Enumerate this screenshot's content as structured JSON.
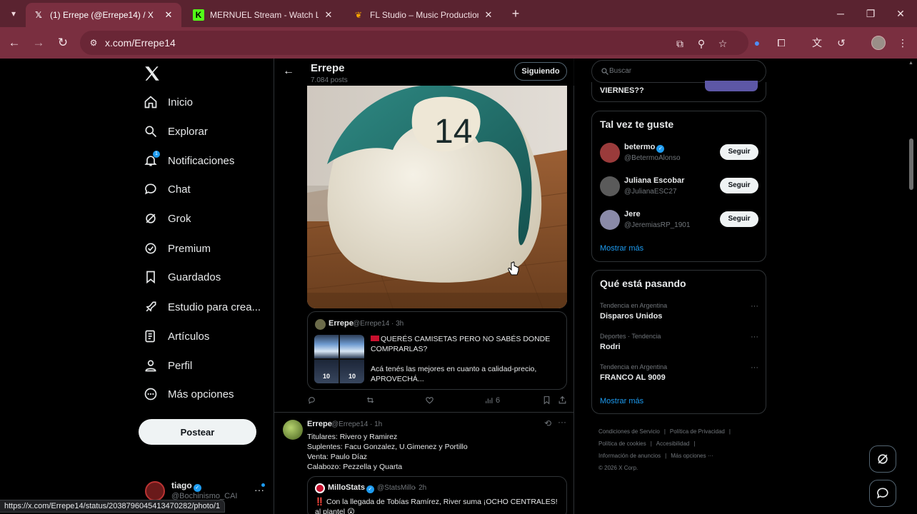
{
  "browser": {
    "tabs": [
      {
        "title": "(1) Errepe (@Errepe14) / X",
        "favicon": "x-logo"
      },
      {
        "title": "MERNUEL Stream - Watch Live",
        "favicon": "kick-logo"
      },
      {
        "title": "FL Studio – Music Production Software",
        "favicon": "fl-studio-logo"
      }
    ],
    "url": "x.com/Errepe14",
    "status_url": "https://x.com/Errepe14/status/2038796045413470282/photo/1",
    "accent": "#7a2f40"
  },
  "nav": {
    "items": [
      {
        "label": "Inicio",
        "icon": "home-icon"
      },
      {
        "label": "Explorar",
        "icon": "search-icon"
      },
      {
        "label": "Notificaciones",
        "icon": "bell-icon",
        "badge": "1"
      },
      {
        "label": "Chat",
        "icon": "chat-icon"
      },
      {
        "label": "Grok",
        "icon": "grok-icon"
      },
      {
        "label": "Premium",
        "icon": "premium-icon"
      },
      {
        "label": "Guardados",
        "icon": "bookmark-icon"
      },
      {
        "label": "Estudio para crea...",
        "icon": "rocket-icon"
      },
      {
        "label": "Artículos",
        "icon": "article-icon"
      },
      {
        "label": "Perfil",
        "icon": "person-icon"
      },
      {
        "label": "Más opciones",
        "icon": "more-circle-icon"
      }
    ],
    "post_button": "Postear",
    "account": {
      "name": "tiago",
      "handle": "@Bochinismo_CAI"
    }
  },
  "profile_header": {
    "name": "Errepe",
    "posts": "7.084 posts",
    "follow_state": "Siguiendo"
  },
  "tweet1": {
    "photo_text": "14",
    "quote": {
      "name": "Errepe",
      "handle": "@Errepe14",
      "time": "· 3h",
      "line1": "QUERÉS CAMISETAS PERO NO SABÉS DONDE COMPRARLAS?",
      "line2": "Acá tenés las mejores en cuanto a calidad-precio, APROVECHÁ...",
      "thumb_numbers": [
        "10",
        "10"
      ]
    },
    "views": "6"
  },
  "tweet2": {
    "name": "Errepe",
    "handle": "@Errepe14",
    "time": "· 1h",
    "lines": [
      "Titulares: Rivero y Ramirez",
      "Suplentes: Facu Gonzalez, U.Gimenez y Portillo",
      "Venta: Paulo Díaz",
      "Calabozo: Pezzella y Quarta"
    ],
    "quote": {
      "name": "MilloStats",
      "handle": "@StatsMillo",
      "time": "· 2h",
      "text_start": "‼️ Con la llegada de Tobías Ramírez, River",
      "text_end": "suma ¡OCHO CENTRALES! al plantel 😲"
    }
  },
  "sidebar": {
    "search_placeholder": "Buscar",
    "top_card_text": "VIERNES??",
    "suggestions_title": "Tal vez te guste",
    "suggestions": [
      {
        "name": "betermo",
        "handle": "@BetermoAlonso",
        "verified": true,
        "button": "Seguir",
        "avatar": "#9a3b3b"
      },
      {
        "name": "Juliana Escobar",
        "handle": "@JulianaESC27",
        "verified": false,
        "button": "Seguir",
        "avatar": "#5a5a5a"
      },
      {
        "name": "Jere",
        "handle": "@JeremiasRP_1901",
        "verified": false,
        "button": "Seguir",
        "avatar": "#8a8aa8"
      }
    ],
    "show_more": "Mostrar más",
    "trends_title": "Qué está pasando",
    "trends": [
      {
        "context": "Tendencia en Argentina",
        "topic": "Disparos Unidos"
      },
      {
        "context": "Deportes · Tendencia",
        "topic": "Rodri"
      },
      {
        "context": "Tendencia en Argentina",
        "topic": "FRANCO AL 9009"
      }
    ],
    "trends_more": "Mostrar más",
    "footer": [
      "Condiciones de Servicio",
      "Política de Privacidad",
      "Política de cookies",
      "Accesibilidad",
      "Información de anuncios",
      "Más opciones ···",
      "© 2026 X Corp."
    ]
  }
}
